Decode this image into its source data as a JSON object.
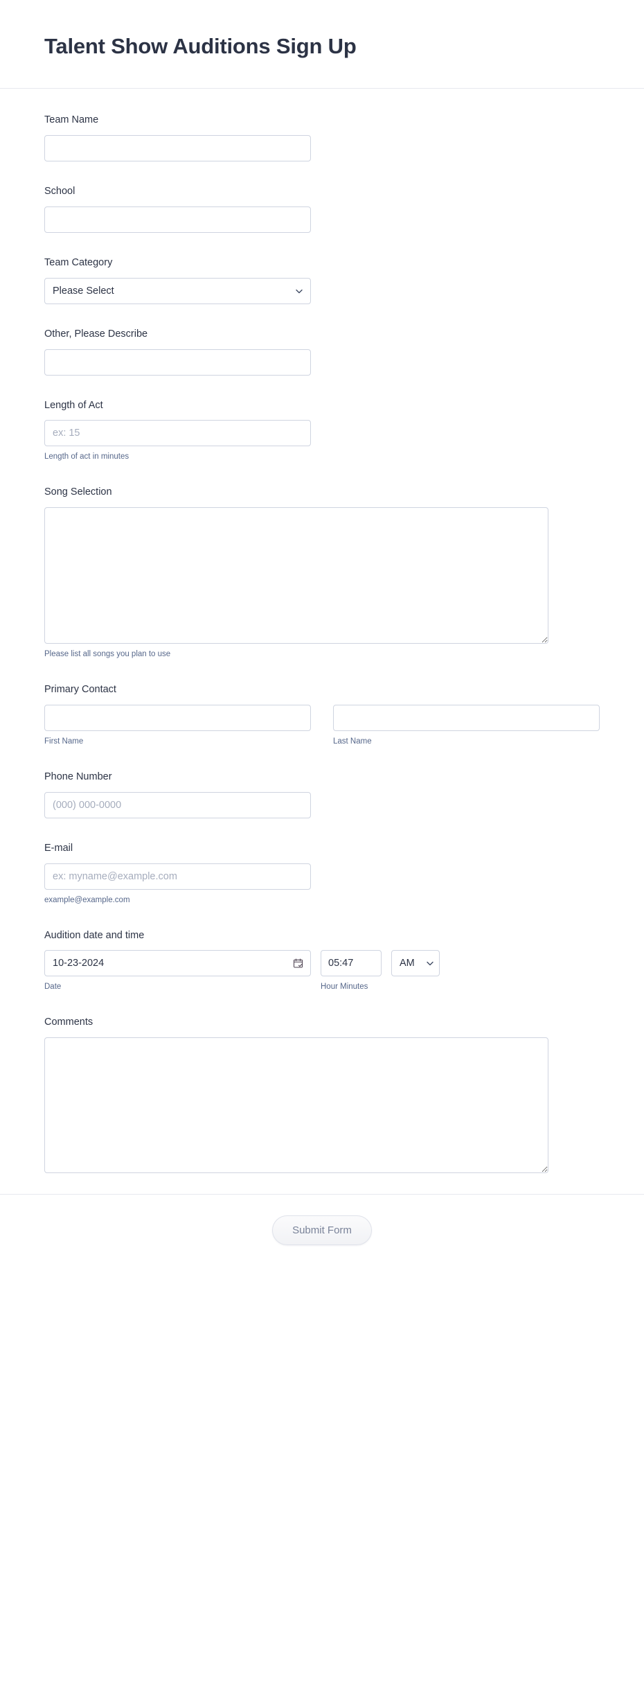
{
  "header": {
    "title": "Talent Show Auditions Sign Up"
  },
  "fields": {
    "team_name": {
      "label": "Team Name",
      "value": "",
      "placeholder": ""
    },
    "school": {
      "label": "School",
      "value": "",
      "placeholder": ""
    },
    "team_category": {
      "label": "Team Category",
      "selected": "Please Select",
      "icon": "chevron-down-icon"
    },
    "other_describe": {
      "label": "Other, Please Describe",
      "value": "",
      "placeholder": ""
    },
    "length_of_act": {
      "label": "Length of Act",
      "value": "",
      "placeholder": "ex: 15",
      "hint": "Length of act in minutes"
    },
    "song_selection": {
      "label": "Song Selection",
      "value": "",
      "placeholder": "",
      "hint": "Please list all songs you plan to use"
    },
    "primary_contact": {
      "label": "Primary Contact",
      "first": {
        "value": "",
        "placeholder": "",
        "hint": "First Name"
      },
      "last": {
        "value": "",
        "placeholder": "",
        "hint": "Last Name"
      }
    },
    "phone_number": {
      "label": "Phone Number",
      "value": "",
      "placeholder": "(000) 000-0000"
    },
    "email": {
      "label": "E-mail",
      "value": "",
      "placeholder": "ex: myname@example.com",
      "hint": "example@example.com"
    },
    "audition_datetime": {
      "label": "Audition date and time",
      "date_value": "10-23-2024",
      "date_hint": "Date",
      "date_icon": "calendar-icon",
      "time_value": "05:47",
      "time_hint": "Hour Minutes",
      "ampm_value": "AM",
      "ampm_icon": "chevron-down-icon"
    },
    "comments": {
      "label": "Comments",
      "value": "",
      "placeholder": ""
    }
  },
  "footer": {
    "submit_label": "Submit Form"
  },
  "colors": {
    "title": "#2c3345",
    "label": "#2c3345",
    "sublabel": "#56678a",
    "border": "#cfd4e0",
    "placeholder": "#a6adbd",
    "divider": "#e6e8ef",
    "submit_text": "#7a8399"
  }
}
